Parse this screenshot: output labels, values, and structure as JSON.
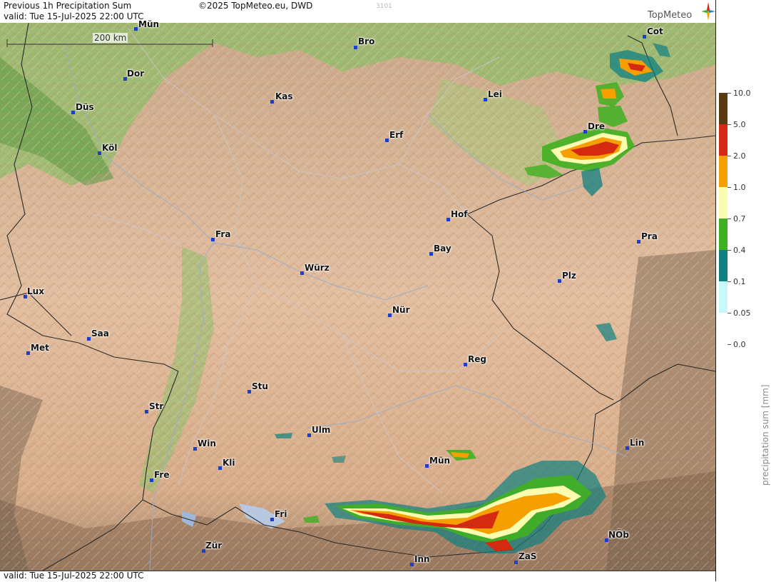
{
  "header": {
    "title": "Previous 1h Precipitation Sum",
    "valid": "valid:  Tue  15-Jul-2025 22:00 UTC",
    "copyright": "©2025 TopMeteo.eu, DWD",
    "code": "3101",
    "brand": "TopMeteo"
  },
  "footer": {
    "valid": "valid:  Tue  15-Jul-2025 22:00 UTC"
  },
  "scale_bar": {
    "label": "200 km"
  },
  "cities": [
    {
      "label": "Mün"
    },
    {
      "label": "Dor"
    },
    {
      "label": "Düs"
    },
    {
      "label": "Köl"
    },
    {
      "label": "Kas"
    },
    {
      "label": "Bro"
    },
    {
      "label": "Lei"
    },
    {
      "label": "Erf"
    },
    {
      "label": "Cot"
    },
    {
      "label": "Dre"
    },
    {
      "label": "Fra"
    },
    {
      "label": "Hof"
    },
    {
      "label": "Bay"
    },
    {
      "label": "Pra"
    },
    {
      "label": "Würz"
    },
    {
      "label": "Lux"
    },
    {
      "label": "Plz"
    },
    {
      "label": "Nür"
    },
    {
      "label": "Saa"
    },
    {
      "label": "Met"
    },
    {
      "label": "Reg"
    },
    {
      "label": "Stu"
    },
    {
      "label": "Str"
    },
    {
      "label": "Ulm"
    },
    {
      "label": "Win"
    },
    {
      "label": "Lin"
    },
    {
      "label": "Kli"
    },
    {
      "label": "Mün"
    },
    {
      "label": "Fre"
    },
    {
      "label": "Fri"
    },
    {
      "label": "NÖb"
    },
    {
      "label": "Zür"
    },
    {
      "label": "ZaS"
    },
    {
      "label": "Inn"
    }
  ],
  "legend": {
    "title": "precipitation sum [mm]",
    "levels": [
      {
        "value": "10.0",
        "color": "#5a3a10"
      },
      {
        "value": "5.0",
        "color": "#d42a12"
      },
      {
        "value": "2.0",
        "color": "#f5a000"
      },
      {
        "value": "1.0",
        "color": "#fafcb0"
      },
      {
        "value": "0.7",
        "color": "#40b020"
      },
      {
        "value": "0.4",
        "color": "#108080"
      },
      {
        "value": "0.1",
        "color": "#c8f8fa"
      },
      {
        "value": "0.05",
        "color": "#ffffff"
      },
      {
        "value": "0.0",
        "color": "#ffffff"
      }
    ]
  }
}
